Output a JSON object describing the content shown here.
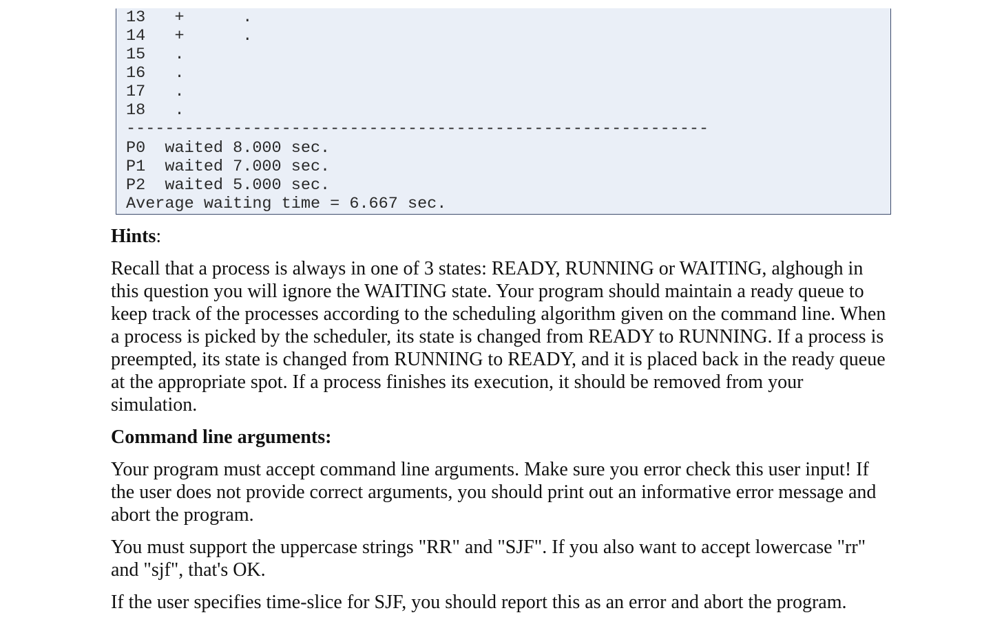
{
  "code_output": {
    "lines": [
      "13   +      .",
      "14   +      .",
      "15   .",
      "16   .",
      "17   .",
      "18   .",
      "------------------------------------------------------------",
      "P0  waited 8.000 sec.",
      "P1  waited 7.000 sec.",
      "P2  waited 5.000 sec.",
      "Average waiting time = 6.667 sec."
    ]
  },
  "hints": {
    "heading": "Hints",
    "heading_suffix": ":",
    "paragraph": "Recall that a process is always in one of 3 states: READY, RUNNING or WAITING, alghough in this question you will ignore the WAITING state. Your program should maintain a ready queue to keep track of the processes according to the scheduling algorithm given on the command line. When a process is picked by the scheduler, its state is changed from READY to RUNNING. If a process is preempted, its state is changed from RUNNING to READY, and it is placed back in the ready queue at the appropriate spot. If a process finishes its execution, it should be removed from your simulation."
  },
  "command_line": {
    "heading": "Command line arguments:",
    "paragraphs": [
      "Your program must accept command line arguments. Make sure you error check this user input! If the user does not provide correct arguments, you should print out an informative error message and abort the program.",
      "You must support the uppercase strings \"RR\" and \"SJF\". If you also want to accept lowercase \"rr\" and \"sjf\", that's OK.",
      "If the user specifies time-slice for SJF, you should report this as an error and abort the program."
    ]
  }
}
